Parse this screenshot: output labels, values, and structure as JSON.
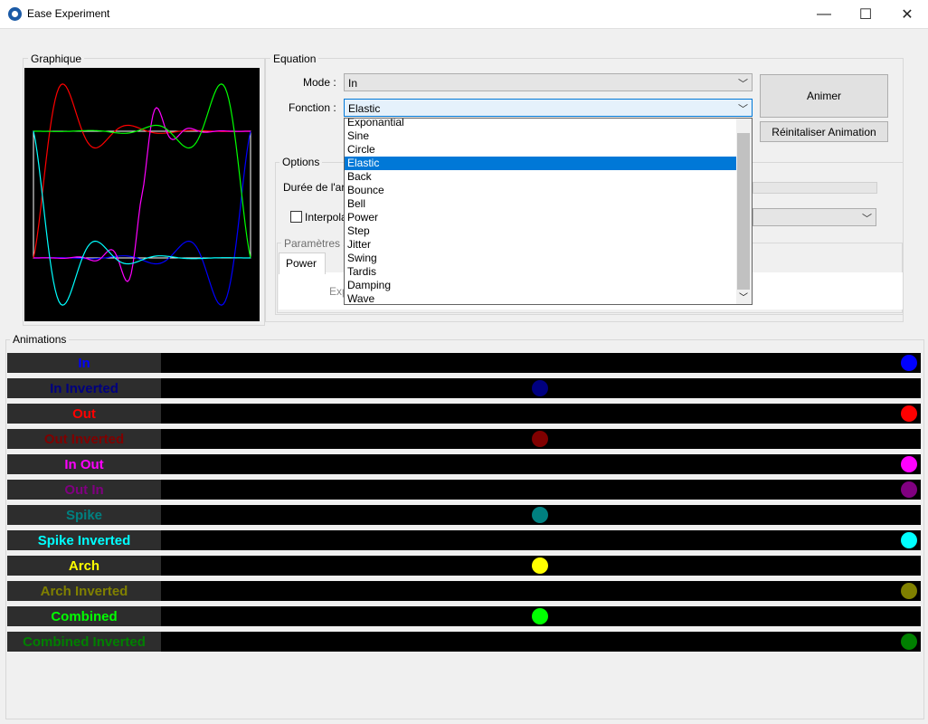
{
  "window": {
    "title": "Ease Experiment",
    "minimize": "—",
    "maximize": "☐",
    "close": "✕"
  },
  "graph": {
    "legend": "Graphique"
  },
  "equation": {
    "legend": "Equation",
    "mode_label": "Mode :",
    "mode_value": "In",
    "fonction_label": "Fonction :",
    "fonction_value": "Elastic",
    "animate_button": "Animer",
    "reset_button": "Réinitaliser Animation",
    "options_legend": "Options",
    "duree_label": "Durée de l'ar",
    "interp_label": "Interpola",
    "params_legend": "Paramètres s",
    "power_tab": "Power",
    "exp_label": "Exp"
  },
  "dropdown": {
    "items": [
      "Exponantial",
      "Sine",
      "Circle",
      "Elastic",
      "Back",
      "Bounce",
      "Bell",
      "Power",
      "Step",
      "Jitter",
      "Swing",
      "Tardis",
      "Damping",
      "Wave"
    ],
    "selected": "Elastic"
  },
  "animations": {
    "legend": "Animations",
    "rows": [
      {
        "label": "In",
        "color": "#0000ff",
        "ball_pos": 1.0
      },
      {
        "label": "In Inverted",
        "color": "#000080",
        "ball_pos": 0.5
      },
      {
        "label": "Out",
        "color": "#ff0000",
        "ball_pos": 1.0
      },
      {
        "label": "Out Inverted",
        "color": "#800000",
        "ball_pos": 0.5
      },
      {
        "label": "In Out",
        "color": "#ff00ff",
        "ball_pos": 1.0
      },
      {
        "label": "Out In",
        "color": "#800080",
        "ball_pos": 1.0
      },
      {
        "label": "Spike",
        "color": "#008080",
        "ball_pos": 0.5
      },
      {
        "label": "Spike Inverted",
        "color": "#00ffff",
        "ball_pos": 1.0
      },
      {
        "label": "Arch",
        "color": "#ffff00",
        "ball_pos": 0.5
      },
      {
        "label": "Arch Inverted",
        "color": "#808000",
        "ball_pos": 1.0
      },
      {
        "label": "Combined",
        "color": "#00ff00",
        "ball_pos": 0.5
      },
      {
        "label": "Combined Inverted",
        "color": "#008000",
        "ball_pos": 1.0
      }
    ]
  }
}
